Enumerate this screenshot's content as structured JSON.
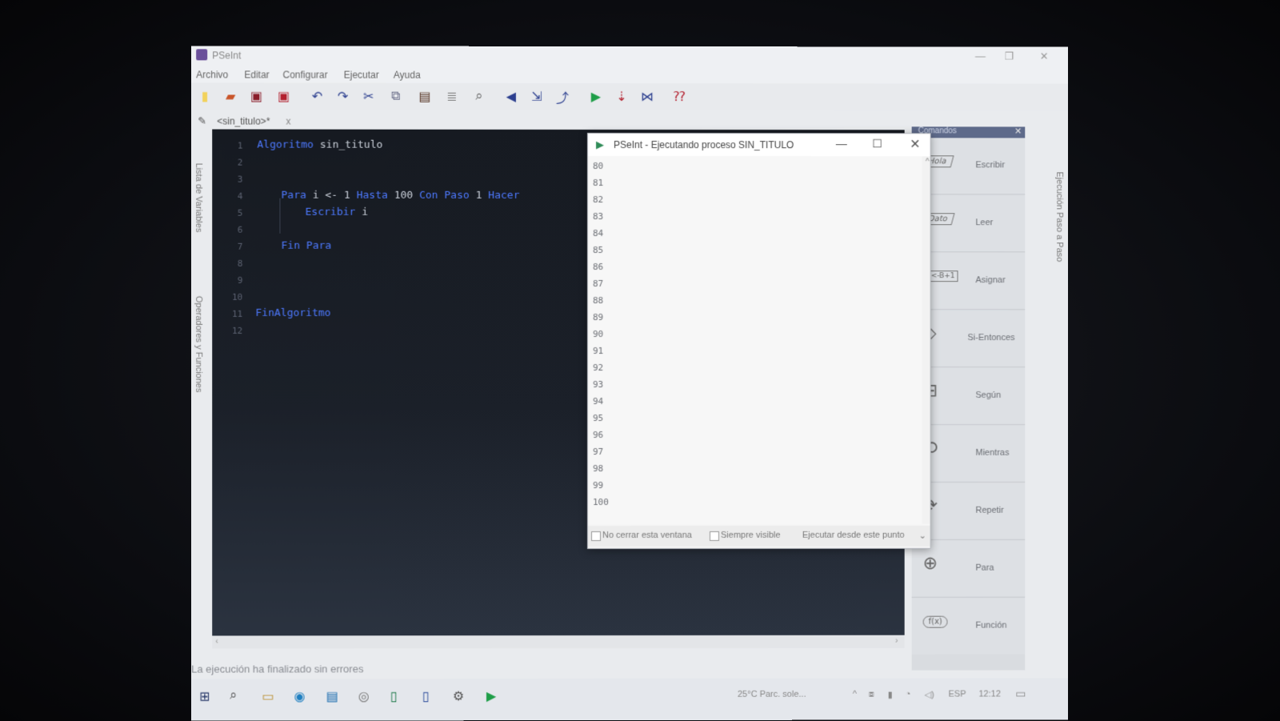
{
  "window": {
    "title": "PSeInt"
  },
  "menu": {
    "items": [
      "Archivo",
      "Editar",
      "Configurar",
      "Ejecutar",
      "Ayuda"
    ]
  },
  "toolbar": {
    "icons": [
      "new-file-icon",
      "open-folder-icon",
      "save-icon",
      "save-as-icon",
      "undo-icon",
      "redo-icon",
      "cut-icon",
      "copy-icon",
      "paste-icon",
      "text-icon",
      "find-icon",
      "indent-icon",
      "outdent-icon",
      "comment-icon",
      "run-icon",
      "step-icon",
      "flowchart-icon",
      "help-icon"
    ]
  },
  "tab": {
    "label": "<sin_titulo>*",
    "close": "x"
  },
  "left_panel": {
    "variables_label": "Lista de Variables",
    "operators_label": "Operadores y Funciones"
  },
  "right_panel": {
    "step_label": "Ejecución Paso a Paso"
  },
  "editor": {
    "line_numbers": [
      "1",
      "2",
      "3",
      "4",
      "5",
      "6",
      "7",
      "8",
      "9",
      "10",
      "11",
      "12"
    ],
    "code": {
      "l1_kw": "Algoritmo",
      "l1_name": "sin_titulo",
      "l4_a": "Para",
      "l4_b": "i",
      "l4_c": "<-",
      "l4_d": "1",
      "l4_e": "Hasta",
      "l4_f": "100",
      "l4_g": "Con Paso",
      "l4_h": "1",
      "l4_i": "Hacer",
      "l5_a": "Escribir",
      "l5_b": "i",
      "l7": "Fin Para",
      "l11": "FinAlgoritmo"
    }
  },
  "exec_window": {
    "title": "PSeInt - Ejecutando proceso SIN_TITULO",
    "output": [
      "80",
      "81",
      "82",
      "83",
      "84",
      "85",
      "86",
      "87",
      "88",
      "89",
      "90",
      "91",
      "92",
      "93",
      "94",
      "95",
      "96",
      "97",
      "98",
      "99",
      "100"
    ],
    "no_close": "No cerrar esta ventana",
    "always_visible": "Siempre visible",
    "run_from": "Ejecutar desde este punto"
  },
  "commands": {
    "title": "Comandos",
    "items": [
      {
        "label": "Escribir",
        "glyph": "Hola"
      },
      {
        "label": "Leer",
        "glyph": "Dato"
      },
      {
        "label": "Asignar",
        "glyph": "A<-B+1"
      },
      {
        "label": "Si-Entonces",
        "glyph": "◇"
      },
      {
        "label": "Según",
        "glyph": "⊞"
      },
      {
        "label": "Mientras",
        "glyph": "⟲"
      },
      {
        "label": "Repetir",
        "glyph": "⟳"
      },
      {
        "label": "Para",
        "glyph": "⊕"
      },
      {
        "label": "Función",
        "glyph": "f(x)"
      }
    ]
  },
  "status": {
    "text": "La ejecución ha finalizado sin errores"
  },
  "taskbar": {
    "weather": "25°C  Parc. sole...",
    "lang": "ESP",
    "time": "12:12"
  },
  "colors": {
    "editor_bg": "#161a21",
    "keyword": "#4d79ff",
    "exec_bg": "#f7f7f7",
    "panel_header": "#5e6a8a"
  }
}
